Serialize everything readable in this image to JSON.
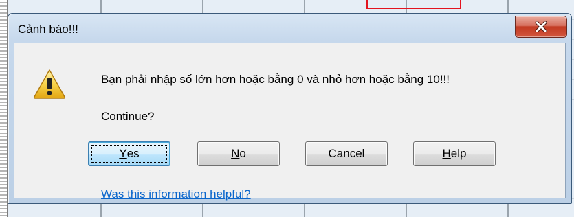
{
  "colors": {
    "link": "#0a66cc",
    "close_button_red": "#c23a22",
    "default_button_border": "#3c7fb1",
    "background_highlight_red": "#e3141f"
  },
  "dialog": {
    "title": "Cảnh báo!!!",
    "close_icon": "close-icon",
    "icon": "warning-icon",
    "message": "Bạn phải nhập số lớn hơn hoặc bằng 0 và nhỏ hơn hoặc bằng 10!!!",
    "question": "Continue?",
    "buttons": {
      "yes": {
        "mnemonic": "Y",
        "rest": "es"
      },
      "no": {
        "mnemonic": "N",
        "rest": "o"
      },
      "cancel": {
        "label": "Cancel"
      },
      "help": {
        "mnemonic": "H",
        "rest": "elp"
      }
    },
    "help_link": "Was this information helpful?"
  }
}
